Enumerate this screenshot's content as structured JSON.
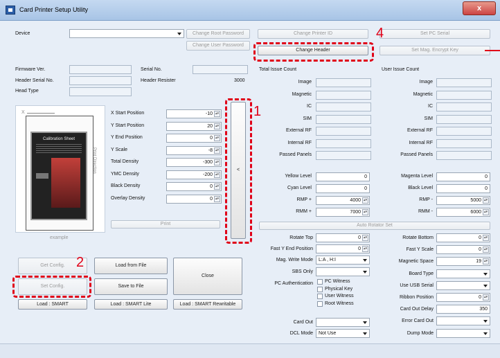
{
  "title": "Card Printer Setup Utility",
  "close_glyph": "x",
  "device": {
    "label": "Device",
    "value": ""
  },
  "top_buttons": {
    "change_root_password": "Change Root Password",
    "change_user_password": "Change User Password",
    "change_printer_id": "Change Printer ID",
    "change_header": "Change Header",
    "set_pc_serial": "Set PC Serial",
    "set_mag_encrypt_key": "Set Mag. Encrypt Key"
  },
  "info": {
    "firmware_ver": "Firmware Ver.",
    "header_serial_no": "Header Serial No.",
    "head_type": "Head Type",
    "serial_no": "Serial No.",
    "header_resister": "Header Resister",
    "header_resister_value": "3000"
  },
  "preview": {
    "x_label": "X",
    "y_label": "Y",
    "calibration": "Calibration Sheet",
    "fine_line": "Print Direction",
    "caption": "example"
  },
  "positions": [
    {
      "label": "X Start Position",
      "value": "-10"
    },
    {
      "label": "Y Start Position",
      "value": "20"
    },
    {
      "label": "Y End Position",
      "value": "0"
    },
    {
      "label": "Y Scale",
      "value": "-8"
    },
    {
      "label": "Total Density",
      "value": "-300"
    },
    {
      "label": "YMC Density",
      "value": "-200"
    },
    {
      "label": "Black Density",
      "value": "0"
    },
    {
      "label": "Overlay Density",
      "value": "0"
    }
  ],
  "print_button": "Print",
  "collapse_glyph": "<",
  "total_issue": {
    "title": "Total Issue Count",
    "rows": [
      "Image",
      "Magnetic",
      "IC",
      "SIM",
      "External RF",
      "Internal RF",
      "Passed Panels"
    ]
  },
  "user_issue": {
    "title": "User Issue Count",
    "rows": [
      "Image",
      "Magnetic",
      "IC",
      "SIM",
      "External RF",
      "Internal RF",
      "Passed Panels"
    ]
  },
  "levels_left": [
    {
      "label": "Yellow Level",
      "value": "0"
    },
    {
      "label": "Cyan Level",
      "value": "0"
    },
    {
      "label": "RMP +",
      "value": "4000"
    },
    {
      "label": "RMM +",
      "value": "7000"
    }
  ],
  "levels_right": [
    {
      "label": "Magenta Level",
      "value": "0"
    },
    {
      "label": "Black Level",
      "value": "0"
    },
    {
      "label": "RMP -",
      "value": "5000"
    },
    {
      "label": "RMM -",
      "value": "6000"
    }
  ],
  "auto_rotator": "Auto Rotator Set",
  "rotate": {
    "rotate_top": {
      "label": "Rotate Top",
      "value": "0"
    },
    "fast_y_end": {
      "label": "Fast Y End Position",
      "value": "0"
    },
    "mag_write_mode": {
      "label": "Mag. Write Mode",
      "value": "L:A , H:I"
    },
    "sbs_only": {
      "label": "SBS Only",
      "value": ""
    },
    "pc_auth": {
      "label": "PC Authentication",
      "options": [
        "PC Witness",
        "Physical Key",
        "User Witness",
        "Root Witness"
      ]
    },
    "card_out": {
      "label": "Card Out",
      "value": ""
    },
    "dcl_mode": {
      "label": "DCL Mode",
      "value": "Not Use"
    },
    "rotate_bottom": {
      "label": "Rotate Bottom",
      "value": "0"
    },
    "fast_y_scale": {
      "label": "Fast Y Scale",
      "value": "0"
    },
    "magnetic_space": {
      "label": "Magnetic Space",
      "value": "19"
    },
    "board_type": {
      "label": "Board Type",
      "value": ""
    },
    "use_usb_serial": {
      "label": "Use USB Serial",
      "value": ""
    },
    "ribbon_position": {
      "label": "Ribbon Position",
      "value": "0"
    },
    "card_out_delay": {
      "label": "Card Out Delay",
      "value": "350"
    },
    "error_card_out": {
      "label": "Error Card Out",
      "value": ""
    },
    "dump_mode": {
      "label": "Dump Mode",
      "value": ""
    }
  },
  "bottom_buttons": {
    "get_config": "Get Config.",
    "set_config": "Set Config.",
    "load_from_file": "Load from File",
    "save_to_file": "Save to File",
    "close": "Close",
    "load_smart": "Load : SMART",
    "load_smart_lite": "Load : SMART Lite",
    "load_smart_rewritable": "Load : SMART Rewritable"
  },
  "annotations": [
    "1",
    "2",
    "4"
  ],
  "colors": {
    "annotation": "#e00018",
    "titlebar": "#a8c4e6",
    "window": "#e7eef7"
  }
}
